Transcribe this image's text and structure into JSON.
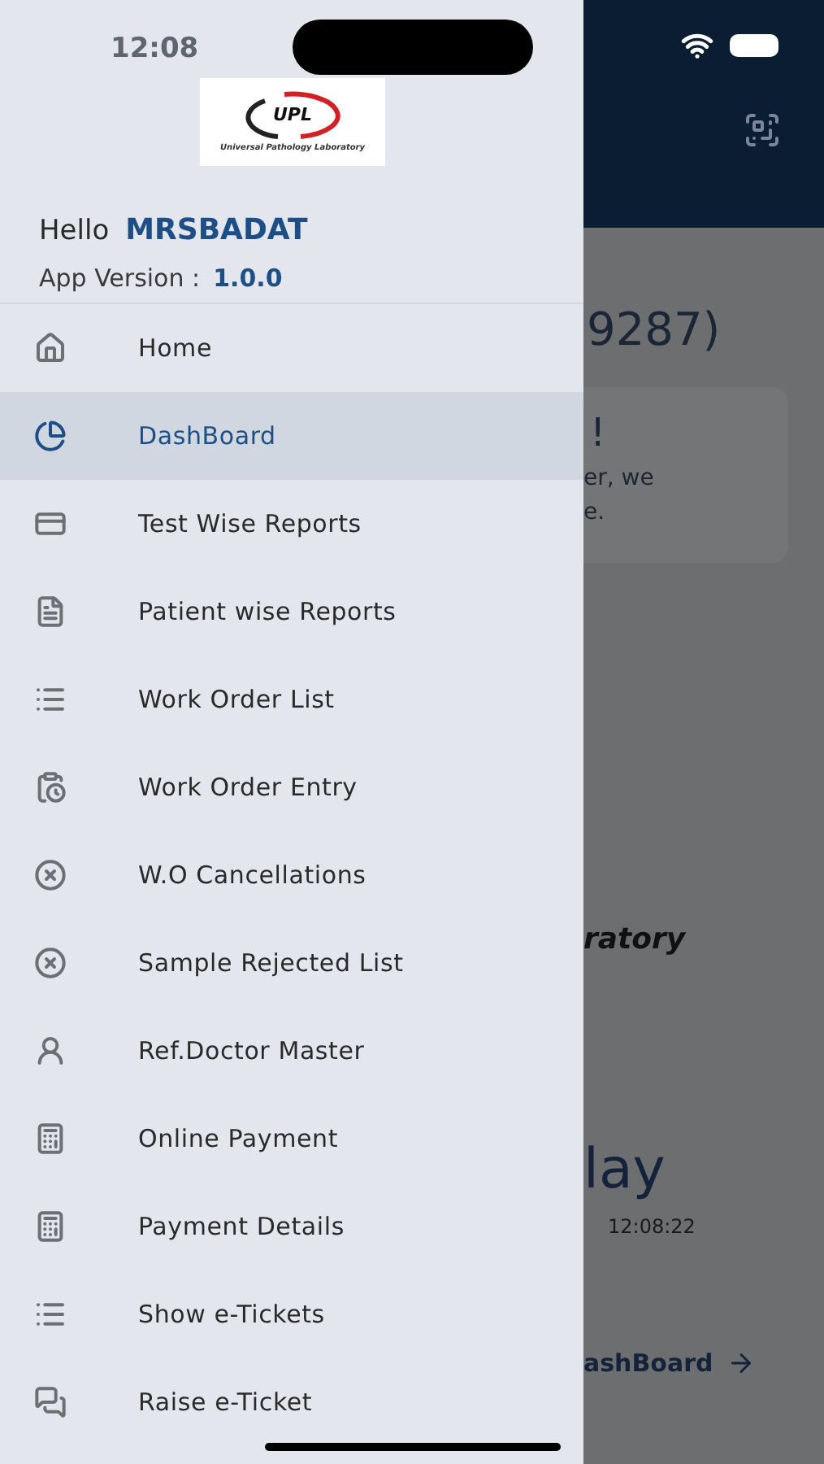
{
  "status_bar": {
    "time": "12:08"
  },
  "drawer": {
    "logo": {
      "mark": "UPL",
      "caption": "Universal Pathology Laboratory"
    },
    "greeting": {
      "label": "Hello",
      "user": "MRSBADAT"
    },
    "version": {
      "label": "App Version :",
      "value": "1.0.0"
    },
    "items": [
      {
        "label": "Home",
        "selected": false
      },
      {
        "label": "DashBoard",
        "selected": true
      },
      {
        "label": "Test Wise Reports",
        "selected": false
      },
      {
        "label": "Patient wise Reports",
        "selected": false
      },
      {
        "label": "Work Order List",
        "selected": false
      },
      {
        "label": "Work Order Entry",
        "selected": false
      },
      {
        "label": "W.O Cancellations",
        "selected": false
      },
      {
        "label": "Sample Rejected List",
        "selected": false
      },
      {
        "label": "Ref.Doctor Master",
        "selected": false
      },
      {
        "label": "Online Payment",
        "selected": false
      },
      {
        "label": "Payment Details",
        "selected": false
      },
      {
        "label": "Show e-Tickets",
        "selected": false
      },
      {
        "label": "Raise e-Ticket",
        "selected": false
      }
    ]
  },
  "background_page": {
    "heading": "9287)",
    "card_title": "!",
    "card_lines": [
      "er, we",
      "e."
    ],
    "banner_text": "ratory",
    "date_text": "lay",
    "time_text": "12:08:22",
    "link": "ashBoard"
  }
}
